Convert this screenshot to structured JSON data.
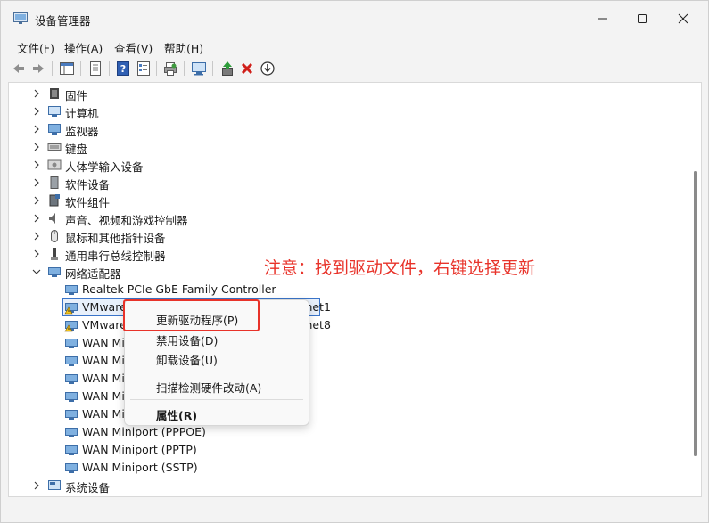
{
  "window": {
    "title": "设备管理器"
  },
  "menubar": {
    "items": [
      "文件(F)",
      "操作(A)",
      "查看(V)",
      "帮助(H)"
    ]
  },
  "tree": {
    "collapsed_top": [
      {
        "label": "固件",
        "icon": "firmware-icon"
      },
      {
        "label": "计算机",
        "icon": "computer-icon"
      },
      {
        "label": "监视器",
        "icon": "monitor-icon"
      },
      {
        "label": "键盘",
        "icon": "keyboard-icon"
      },
      {
        "label": "人体学输入设备",
        "icon": "hid-icon"
      },
      {
        "label": "软件设备",
        "icon": "software-device-icon"
      },
      {
        "label": "软件组件",
        "icon": "software-component-icon"
      },
      {
        "label": "声音、视频和游戏控制器",
        "icon": "sound-icon"
      },
      {
        "label": "鼠标和其他指针设备",
        "icon": "mouse-icon"
      },
      {
        "label": "通用串行总线控制器",
        "icon": "usb-icon"
      }
    ],
    "network_category": {
      "label": "网络适配器",
      "icon": "network-icon"
    },
    "network_children": [
      {
        "label": "Realtek PCIe GbE Family Controller",
        "warning": false
      },
      {
        "label": "VMware Virtual Ethernet Adapter for VMnet1",
        "warning": true,
        "selected": true
      },
      {
        "label": "VMware Virtual Ethernet Adapter for VMnet8",
        "warning": true
      },
      {
        "label": "WAN Miniport (IKEv2)",
        "warning": false
      },
      {
        "label": "WAN Miniport (IP)",
        "warning": false
      },
      {
        "label": "WAN Miniport (IPv6)",
        "warning": false
      },
      {
        "label": "WAN Miniport (L2TP)",
        "warning": false
      },
      {
        "label": "WAN Miniport (Network Monitor)",
        "warning": false
      },
      {
        "label": "WAN Miniport (PPPOE)",
        "warning": false
      },
      {
        "label": "WAN Miniport (PPTP)",
        "warning": false
      },
      {
        "label": "WAN Miniport (SSTP)",
        "warning": false
      }
    ],
    "collapsed_bottom": [
      {
        "label": "系统设备",
        "icon": "system-device-icon"
      }
    ]
  },
  "context_menu": {
    "update_driver": "更新驱动程序(P)",
    "disable_device": "禁用设备(D)",
    "uninstall_device": "卸载设备(U)",
    "scan_hardware": "扫描检测硬件改动(A)",
    "properties": "属性(R)"
  },
  "annotation": {
    "text": "注意：找到驱动文件，右键选择更新",
    "color": "#e8332a"
  }
}
